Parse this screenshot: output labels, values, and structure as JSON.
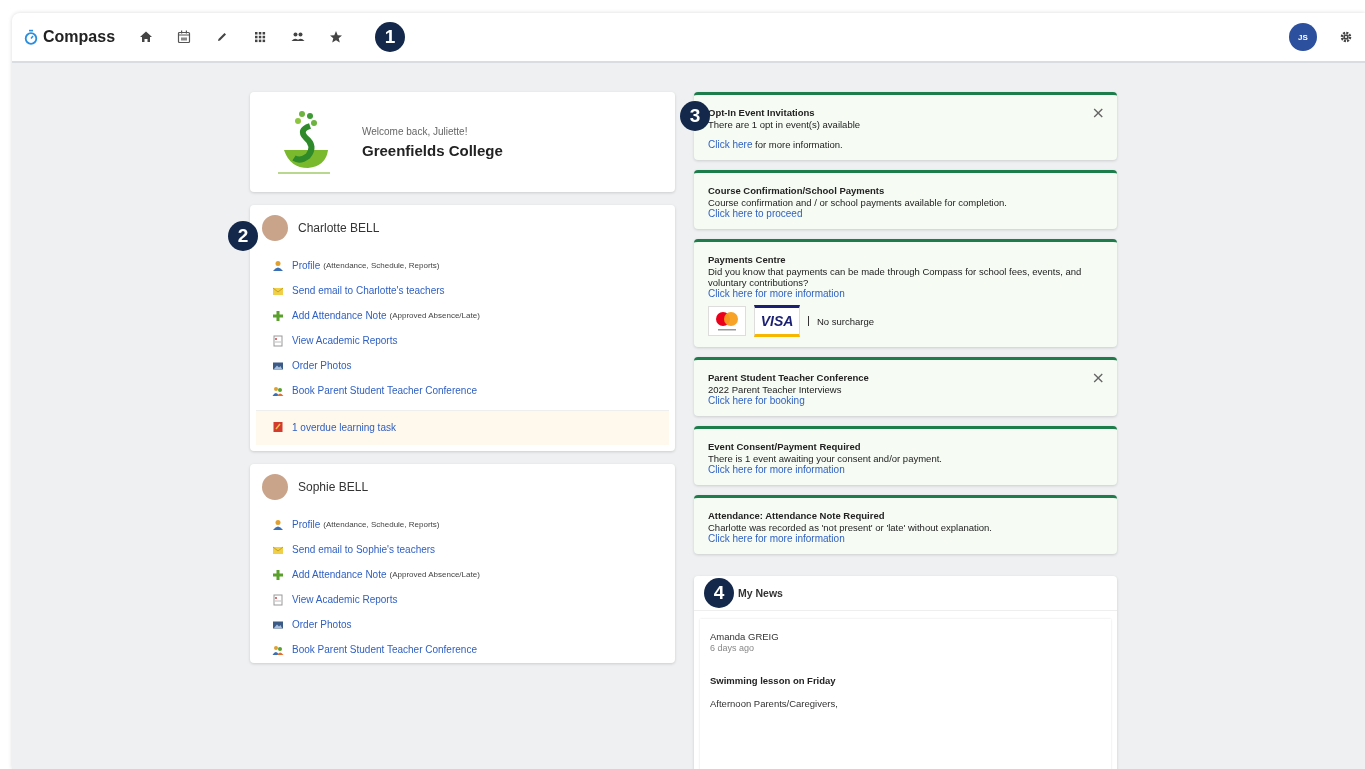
{
  "nav": {
    "logo": "Compass",
    "icons": [
      {
        "kind": "home"
      },
      {
        "kind": "calendar"
      },
      {
        "kind": "pencil"
      },
      {
        "kind": "apps"
      },
      {
        "kind": "people"
      },
      {
        "kind": "star"
      }
    ],
    "callout": "1",
    "avatar": "JS"
  },
  "school": {
    "welcome": "Welcome back, Juliette!",
    "name": "Greenfields College"
  },
  "students": [
    {
      "name": "Charlotte BELL",
      "callout": "2",
      "links": [
        {
          "kind": "profile",
          "label": "Profile",
          "note": "(Attendance, Schedule, Reports)"
        },
        {
          "kind": "email",
          "label": "Send email to Charlotte's teachers"
        },
        {
          "kind": "add",
          "label": "Add Attendance Note",
          "note": "(Approved Absence/Late)"
        },
        {
          "kind": "report",
          "label": "View Academic Reports"
        },
        {
          "kind": "photos",
          "label": "Order Photos"
        },
        {
          "kind": "conference",
          "label": "Book Parent Student Teacher Conference"
        }
      ],
      "tasks": [
        {
          "label": "1 overdue learning task"
        }
      ]
    },
    {
      "name": "Sophie BELL",
      "links": [
        {
          "kind": "profile",
          "label": "Profile",
          "note": "(Attendance, Schedule, Reports)"
        },
        {
          "kind": "email",
          "label": "Send email to Sophie's teachers"
        },
        {
          "kind": "add",
          "label": "Add Attendance Note",
          "note": "(Approved Absence/Late)"
        },
        {
          "kind": "report",
          "label": "View Academic Reports"
        },
        {
          "kind": "photos",
          "label": "Order Photos"
        },
        {
          "kind": "conference",
          "label": "Book Parent Student Teacher Conference"
        }
      ]
    }
  ],
  "alerts": [
    {
      "title": "Opt-In Event Invitations",
      "callout": "3",
      "close": "×",
      "lines": [
        "There are 1 opt in event(s) available"
      ],
      "link": "Click here",
      "link_suffix": "for more information."
    },
    {
      "title": "Course Confirmation/School Payments",
      "lines": [
        "Course confirmation and / or school payments available for completion."
      ],
      "link": "Click here to proceed"
    },
    {
      "title": "Payments Centre",
      "lines": [
        "Did you know that payments can be made through Compass for school fees, events, and voluntary contributions?"
      ],
      "link": "Click here for more information",
      "cards": [
        {
          "kind": "mastercard"
        },
        {
          "kind": "visa",
          "label": "VISA"
        }
      ],
      "cards_note": "No surcharge"
    },
    {
      "title": "Parent Student Teacher Conference",
      "close": "×",
      "lines": [
        "2022 Parent Teacher Interviews"
      ],
      "link": "Click here for booking"
    },
    {
      "title": "Event Consent/Payment Required",
      "lines": [
        "There is 1 event awaiting your consent and/or payment."
      ],
      "link": "Click here for more information"
    },
    {
      "title": "Attendance: Attendance Note Required",
      "lines": [
        "Charlotte was recorded as 'not present' or 'late' without explanation."
      ],
      "link": "Click here for more information"
    }
  ],
  "news": {
    "title": "My News",
    "callout": "4",
    "items": [
      {
        "author": "Amanda GREIG",
        "time": "6 days ago",
        "subject": "Swimming lesson on Friday",
        "body": "Afternoon Parents/Caregivers,"
      }
    ]
  }
}
